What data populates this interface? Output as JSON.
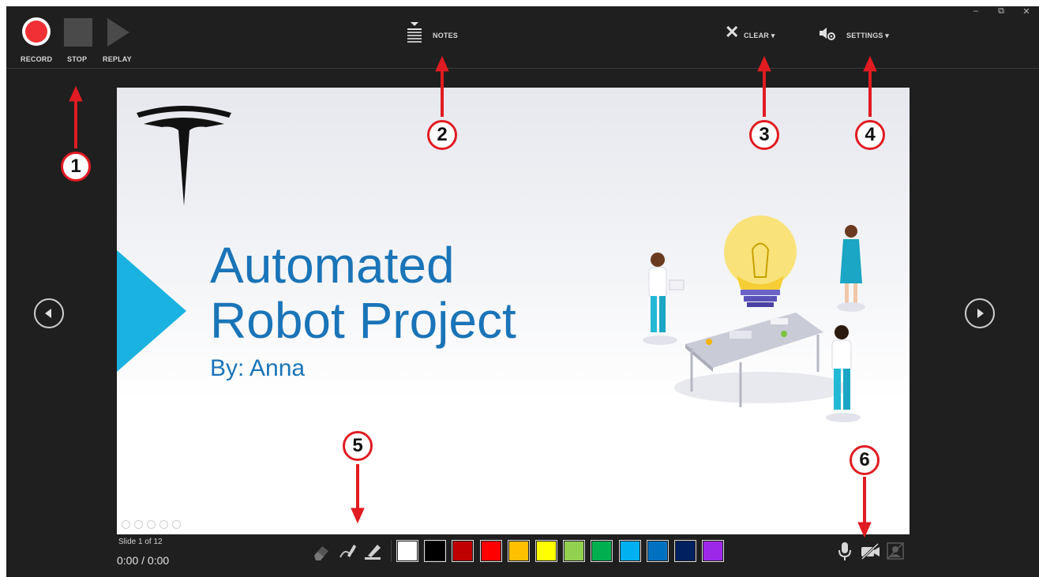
{
  "window": {
    "controls": [
      "–",
      "⧉",
      "✕"
    ]
  },
  "toolbar": {
    "record_label": "RECORD",
    "stop_label": "STOP",
    "replay_label": "REPLAY",
    "notes_label": "NOTES",
    "clear_label": "CLEAR ▾",
    "settings_label": "SETTINGS ▾"
  },
  "annotations": [
    "1",
    "2",
    "3",
    "4",
    "5",
    "6"
  ],
  "slide": {
    "title_line1": "Automated",
    "title_line2": "Robot Project",
    "subtitle": "By: Anna",
    "logo": "tesla-logo",
    "accent_color": "#1ab2e0",
    "text_color": "#1a74b8"
  },
  "status": {
    "slide_counter": "Slide 1 of 12",
    "timer": "0:00 / 0:00"
  },
  "pen_tools": [
    "eraser-icon",
    "pen-icon",
    "highlighter-icon"
  ],
  "colors": [
    "#ffffff",
    "#000000",
    "#c00000",
    "#ff0000",
    "#ffc000",
    "#ffff00",
    "#92d050",
    "#00b050",
    "#00b0f0",
    "#0070c0",
    "#002060",
    "#9e28e8"
  ],
  "media_toggles": [
    "microphone-icon",
    "camera-off-icon",
    "camera-preview-off-icon"
  ]
}
